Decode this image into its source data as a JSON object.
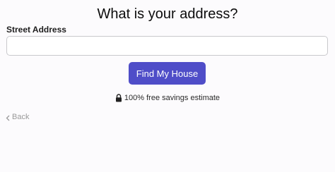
{
  "form": {
    "title": "What is your address?",
    "street_label": "Street Address",
    "street_value": "",
    "street_placeholder": "",
    "submit_label": "Find My House",
    "secure_note": "100% free savings estimate",
    "back_label": "Back"
  },
  "icons": {
    "lock": "lock-icon",
    "back": "chevron-left-icon"
  },
  "colors": {
    "primary_button": "#4f4dc8",
    "back_link": "#9a9a9a"
  }
}
